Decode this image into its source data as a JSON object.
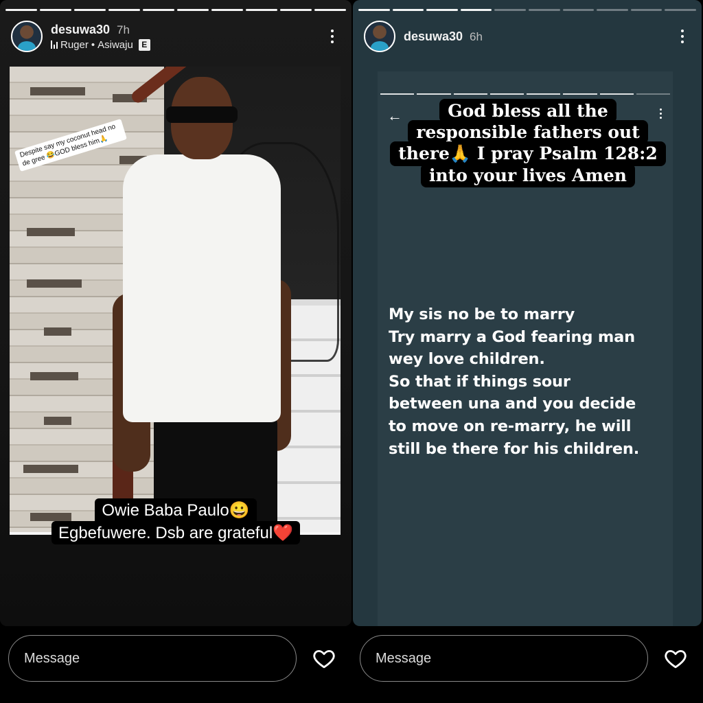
{
  "stories": [
    {
      "username": "desuwa30",
      "time": "7h",
      "music": {
        "artist": "Ruger",
        "separator": "•",
        "title": "Asiwaju",
        "explicit_badge": "E"
      },
      "sticker_text": "Despite say my coconut head no de gree 😂GOD bless him🙏",
      "caption_line1": "Owie Baba Paulo😀",
      "caption_line2": "Egbefuwere. Dsb are grateful❤️",
      "message_placeholder": "Message"
    },
    {
      "username": "desuwa30",
      "time": "6h",
      "blessing_lines": [
        "God bless all the",
        "responsible fathers out",
        "there🙏 I pray Psalm 128:2",
        "into your lives Amen"
      ],
      "message_text": "My sis no be to marry\nTry marry a God fearing man\nwey love children.\nSo that if things sour\nbetween una and you decide\nto move on re-marry, he will\nstill be there for his children.",
      "message_placeholder": "Message"
    }
  ],
  "icons": {
    "more": "more-vertical-icon",
    "heart": "heart-outline-icon",
    "back": "arrow-left-icon",
    "music": "music-bars-icon"
  },
  "colors": {
    "right_story_bg": "#24373f",
    "card_bg": "#2b3e46",
    "input_border": "#8a8a8a"
  }
}
